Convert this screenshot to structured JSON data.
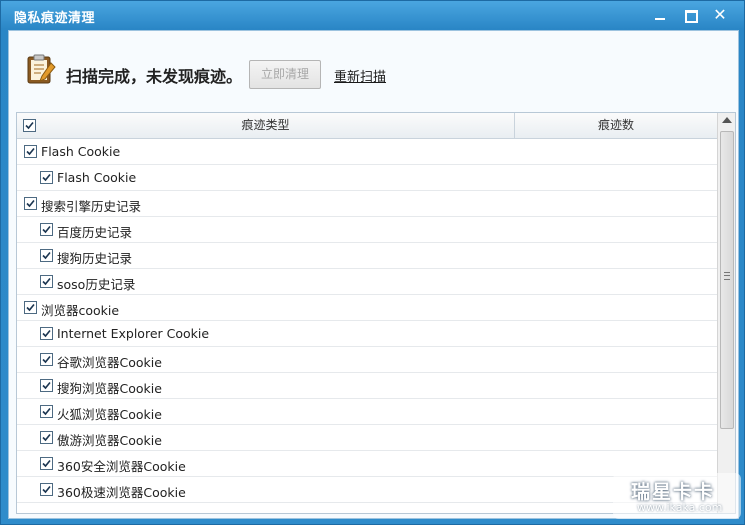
{
  "window": {
    "title": "隐私痕迹清理"
  },
  "summary": {
    "icon": "clipboard-pencil-icon",
    "message": "扫描完成，未发现痕迹。",
    "clean_button": "立即清理",
    "rescan_link": "重新扫描"
  },
  "list": {
    "columns": [
      "痕迹类型",
      "痕迹数"
    ],
    "rows": [
      {
        "label": "Flash Cookie",
        "level": 0,
        "checked": true
      },
      {
        "label": "Flash Cookie",
        "level": 1,
        "checked": true
      },
      {
        "label": "搜索引擎历史记录",
        "level": 0,
        "checked": true
      },
      {
        "label": "百度历史记录",
        "level": 1,
        "checked": true
      },
      {
        "label": "搜狗历史记录",
        "level": 1,
        "checked": true
      },
      {
        "label": "soso历史记录",
        "level": 1,
        "checked": true
      },
      {
        "label": "浏览器cookie",
        "level": 0,
        "checked": true
      },
      {
        "label": "Internet Explorer Cookie",
        "level": 1,
        "checked": true
      },
      {
        "label": "谷歌浏览器Cookie",
        "level": 1,
        "checked": true
      },
      {
        "label": "搜狗浏览器Cookie",
        "level": 1,
        "checked": true
      },
      {
        "label": "火狐浏览器Cookie",
        "level": 1,
        "checked": true
      },
      {
        "label": "傲游浏览器Cookie",
        "level": 1,
        "checked": true
      },
      {
        "label": "360安全浏览器Cookie",
        "level": 1,
        "checked": true
      },
      {
        "label": "360极速浏览器Cookie",
        "level": 1,
        "checked": true
      }
    ]
  },
  "watermark": {
    "main": "瑞星卡卡",
    "url": "www.ikaka.com"
  }
}
